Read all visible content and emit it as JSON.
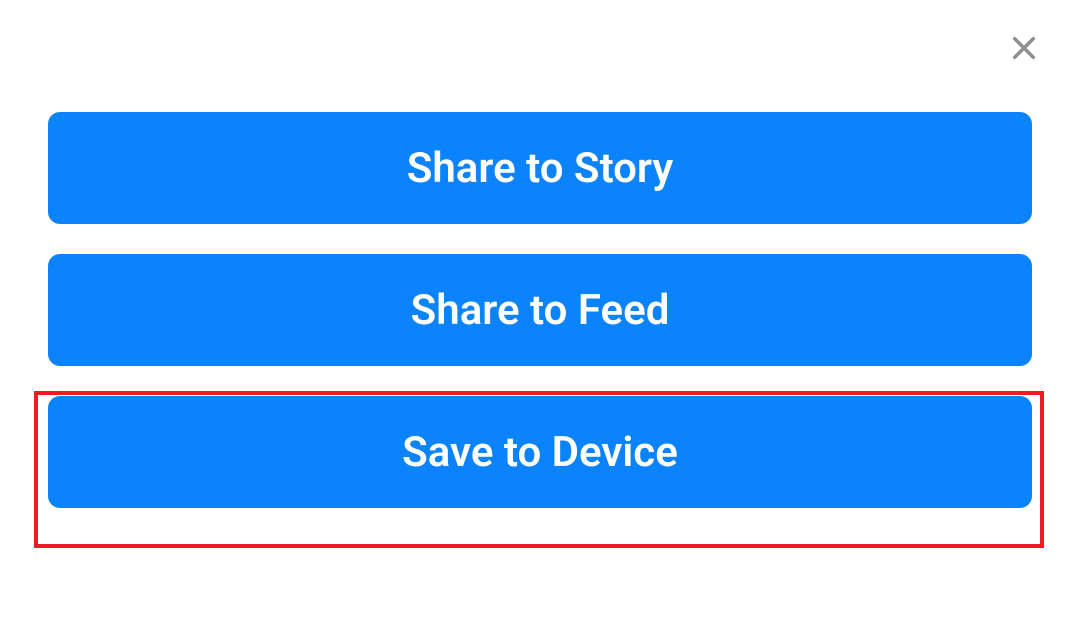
{
  "close": {
    "icon_name": "close-icon"
  },
  "actions": {
    "share_to_story": "Share to Story",
    "share_to_feed": "Share to Feed",
    "save_to_device": "Save to Device"
  },
  "colors": {
    "button_bg": "#0b83fc",
    "button_text": "#ffffff",
    "highlight_border": "#ee1b24",
    "close_icon": "#8e8e8e"
  }
}
